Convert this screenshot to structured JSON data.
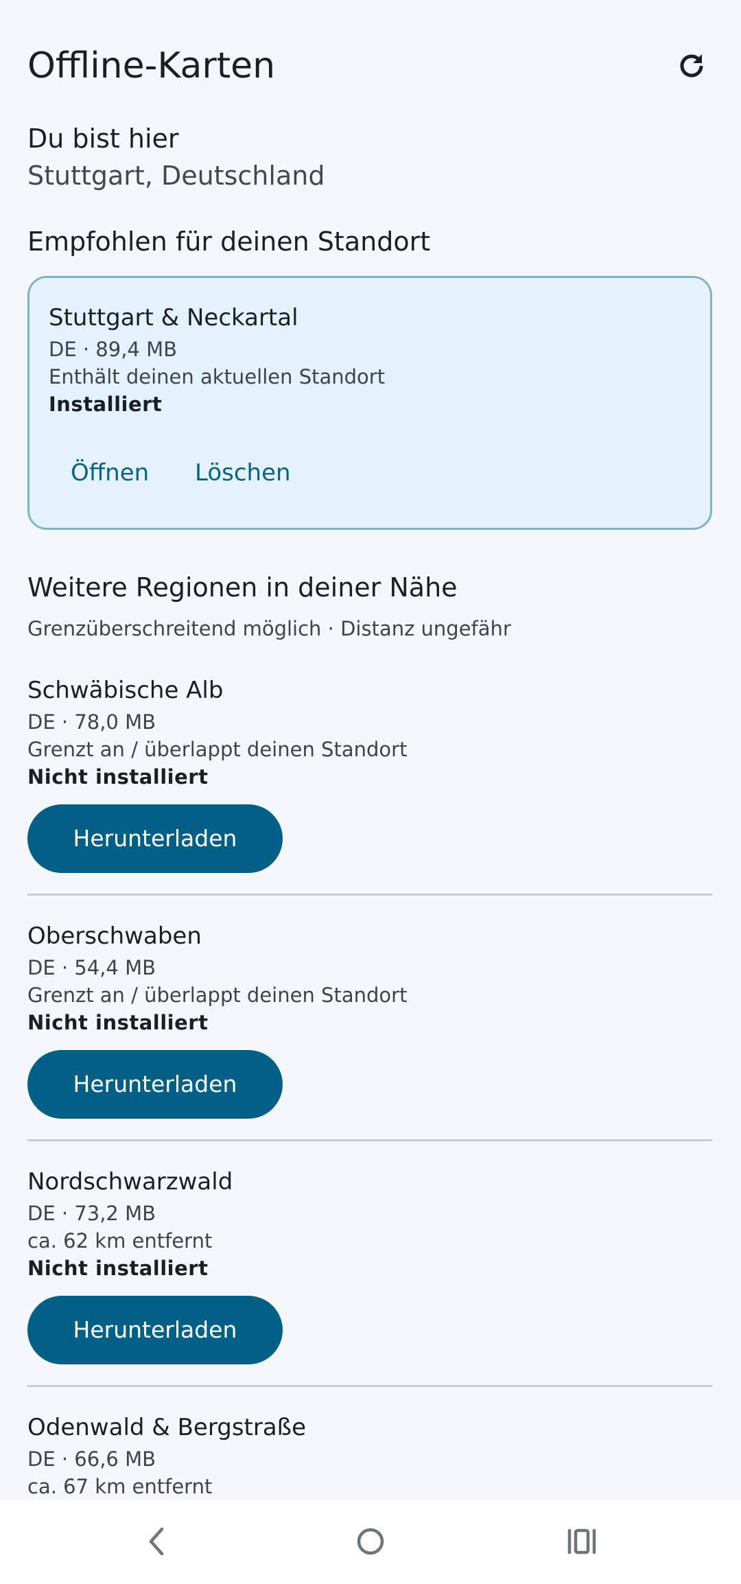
{
  "header": {
    "title": "Offline-Karten",
    "refresh_icon": "refresh-icon"
  },
  "location": {
    "label": "Du bist hier",
    "value": "Stuttgart, Deutschland"
  },
  "recommended": {
    "heading": "Empfohlen für deinen Standort",
    "card": {
      "name": "Stuttgart & Neckartal",
      "meta": "DE · 89,4 MB",
      "note": "Enthält deinen aktuellen Standort",
      "status": "Installiert",
      "open_label": "Öffnen",
      "delete_label": "Löschen"
    }
  },
  "nearby": {
    "heading": "Weitere Regionen in deiner Nähe",
    "subtitle": "Grenzüberschreitend möglich · Distanz ungefähr",
    "regions": [
      {
        "name": "Schwäbische Alb",
        "meta": "DE · 78,0 MB",
        "note": "Grenzt an / überlappt deinen Standort",
        "status": "Nicht installiert",
        "button": "Herunterladen"
      },
      {
        "name": "Oberschwaben",
        "meta": "DE · 54,4 MB",
        "note": "Grenzt an / überlappt deinen Standort",
        "status": "Nicht installiert",
        "button": "Herunterladen"
      },
      {
        "name": "Nordschwarzwald",
        "meta": "DE · 73,2 MB",
        "note": "ca. 62 km entfernt",
        "status": "Nicht installiert",
        "button": "Herunterladen"
      },
      {
        "name": "Odenwald & Bergstraße",
        "meta": "DE · 66,6 MB",
        "note": "ca. 67 km entfernt"
      }
    ]
  },
  "navbar": {
    "back_icon": "back-icon",
    "home_icon": "home-icon",
    "recents_icon": "recents-icon"
  },
  "colors": {
    "background": "#f4f7fc",
    "accent": "#005f85",
    "card_background": "#e3f2fd",
    "card_border": "#7fb3c8"
  }
}
